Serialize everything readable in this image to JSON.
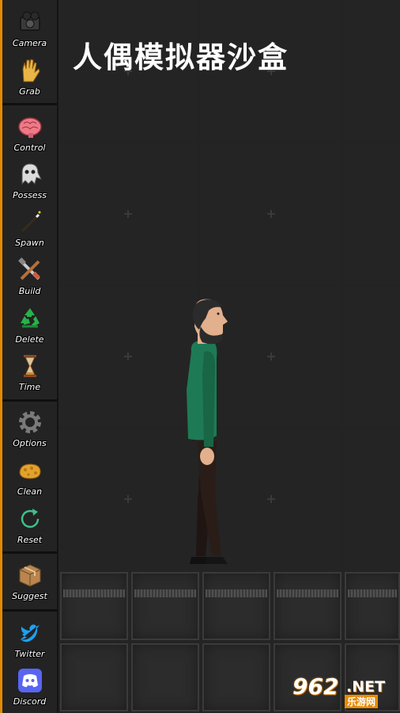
{
  "title": "人偶模拟器沙盒",
  "toolbar": {
    "items": [
      {
        "label": "Camera",
        "icon": "camera-icon"
      },
      {
        "label": "Grab",
        "icon": "hand-icon"
      },
      {
        "label": "Control",
        "icon": "brain-icon"
      },
      {
        "label": "Possess",
        "icon": "ghost-icon"
      },
      {
        "label": "Spawn",
        "icon": "wand-icon"
      },
      {
        "label": "Build",
        "icon": "tools-icon"
      },
      {
        "label": "Delete",
        "icon": "recycle-icon"
      },
      {
        "label": "Time",
        "icon": "hourglass-icon"
      },
      {
        "label": "Options",
        "icon": "gear-icon"
      },
      {
        "label": "Clean",
        "icon": "sponge-icon"
      },
      {
        "label": "Reset",
        "icon": "reset-icon"
      },
      {
        "label": "Suggest",
        "icon": "box-icon"
      },
      {
        "label": "Twitter",
        "icon": "twitter-icon"
      },
      {
        "label": "Discord",
        "icon": "discord-icon"
      }
    ]
  },
  "watermark": {
    "number": "962",
    "suffix": ".NET",
    "site": "乐游网"
  },
  "colors": {
    "accent": "#e38a00",
    "shirt": "#1e7a55",
    "background": "#151515"
  }
}
